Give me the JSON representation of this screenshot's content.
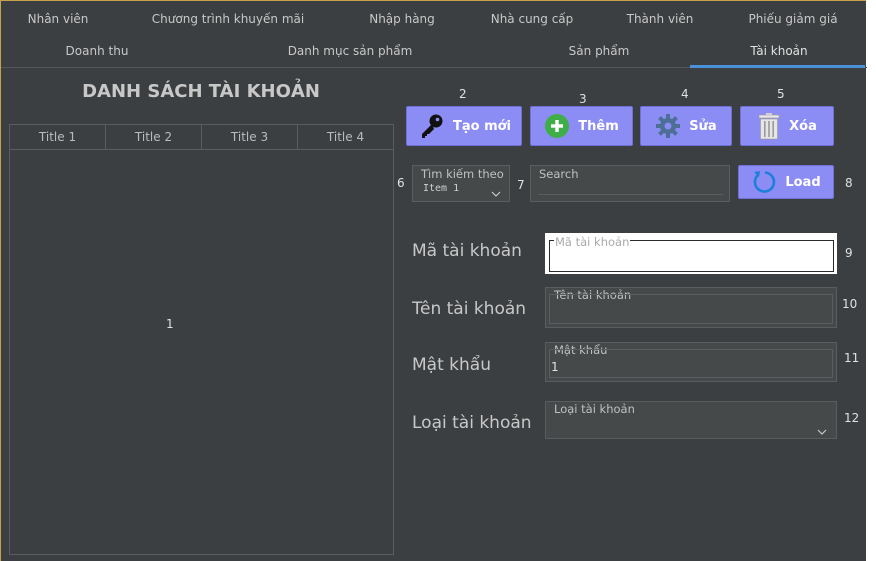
{
  "tabs_row1": [
    "Nhân viên",
    "Chương trình khuyến mãi",
    "Nhập hàng",
    "Nhà cung cấp",
    "Thành viên",
    "Phiếu giảm giá"
  ],
  "tabs_row2": [
    "Doanh thu",
    "Danh mục sản phẩm",
    "Sản phẩm",
    "Tài khoản"
  ],
  "active_tab": "Tài khoản",
  "panel_title": "DANH SÁCH TÀI KHOẢN",
  "table": {
    "columns": [
      "Title 1",
      "Title 2",
      "Title 3",
      "Title 4"
    ],
    "marker": "1"
  },
  "buttons": {
    "create": {
      "label": "Tạo mới",
      "marker": "2"
    },
    "add": {
      "label": "Thêm",
      "marker": "3"
    },
    "edit": {
      "label": "Sửa",
      "marker": "4"
    },
    "delete": {
      "label": "Xóa",
      "marker": "5"
    },
    "load": {
      "label": "Load",
      "marker": "8"
    }
  },
  "search": {
    "by_caption": "Tìm kiếm theo",
    "by_value": "Item 1",
    "by_marker": "6",
    "input_caption": "Search",
    "input_value": "",
    "input_marker": "7"
  },
  "form": {
    "account_id": {
      "label": "Mã tài khoản",
      "caption": "Mã tài khoản",
      "value": "",
      "marker": "9"
    },
    "account_name": {
      "label": "Tên tài khoản",
      "caption": "Tên tài khoản",
      "value": "",
      "marker": "10"
    },
    "password": {
      "label": "Mật khẩu",
      "caption": "Mật khẩu",
      "value": "1",
      "marker": "11"
    },
    "account_type": {
      "label": "Loại tài khoản",
      "caption": "Loại tài khoản",
      "value": "",
      "marker": "12"
    }
  },
  "colors": {
    "background": "#3c3f41",
    "button": "#8c8cf5",
    "active_tab_underline": "#4a90d9",
    "window_border": "#c8a24a"
  }
}
